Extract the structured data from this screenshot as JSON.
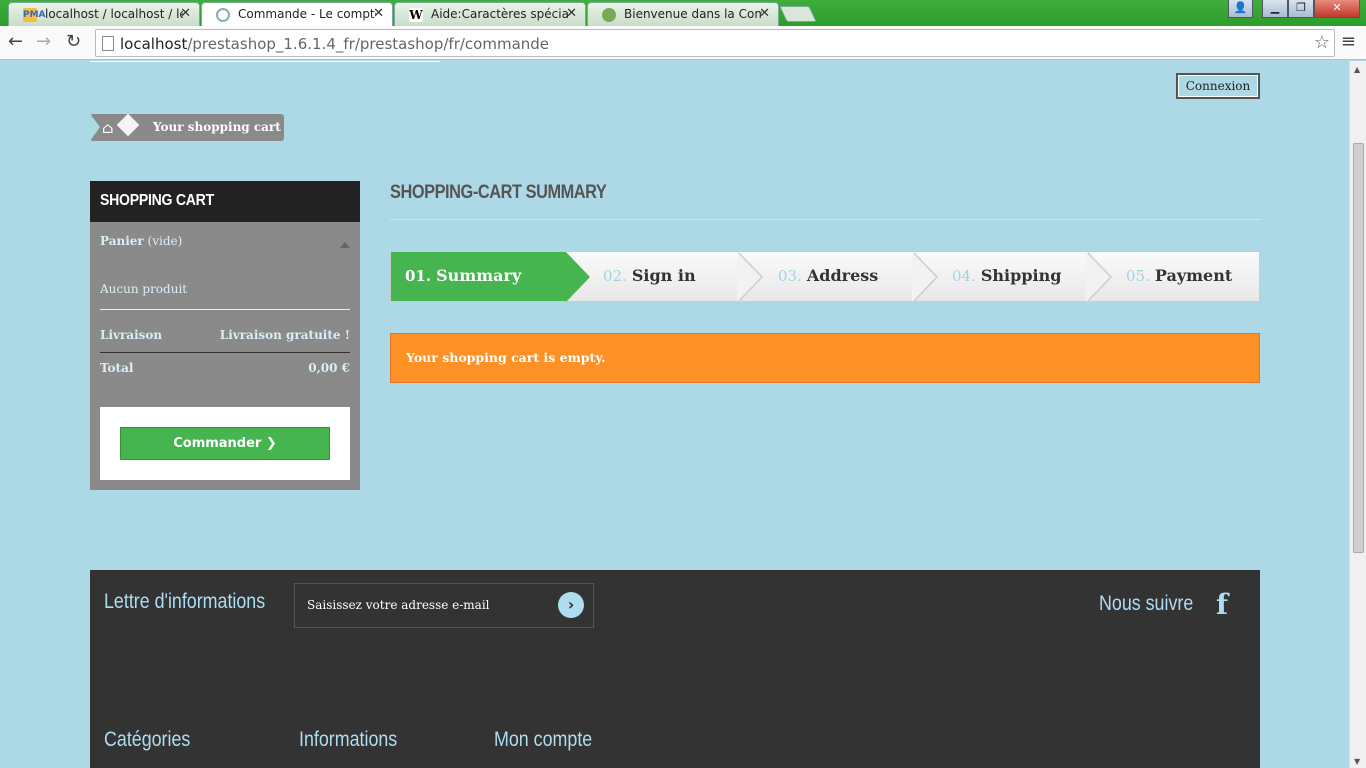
{
  "browser": {
    "tabs": [
      {
        "title": "localhost / localhost / leco",
        "icon": "phpmyadmin-icon"
      },
      {
        "title": "Commande - Le comptoir",
        "icon": "loading-icon",
        "active": true
      },
      {
        "title": "Aide:Caractères spéciaux p",
        "icon": "wikipedia-icon"
      },
      {
        "title": "Bienvenue dans la Commu",
        "icon": "prestashop-icon"
      }
    ],
    "url_host": "localhost",
    "url_path": "/prestashop_1.6.1.4_fr/prestashop/fr/commande"
  },
  "header": {
    "login_label": "Connexion",
    "breadcrumb": "Your shopping cart"
  },
  "cart": {
    "title": "SHOPPING CART",
    "panier_label": "Panier",
    "panier_status": "(vide)",
    "empty_text": "Aucun produit",
    "shipping_label": "Livraison",
    "shipping_value": "Livraison gratuite !",
    "total_label": "Total",
    "total_value": "0,00 €",
    "checkout_label": "Commander"
  },
  "main": {
    "title": "SHOPPING-CART SUMMARY",
    "steps": [
      {
        "num": "01.",
        "label": "Summary"
      },
      {
        "num": "02.",
        "label": "Sign in"
      },
      {
        "num": "03.",
        "label": "Address"
      },
      {
        "num": "04.",
        "label": "Shipping"
      },
      {
        "num": "05.",
        "label": "Payment"
      }
    ],
    "alert": "Your shopping cart is empty."
  },
  "footer": {
    "newsletter_title": "Lettre d'informations",
    "newsletter_placeholder": "Saisissez votre adresse e-mail",
    "follow_title": "Nous suivre",
    "col1": "Catégories",
    "col2": "Informations",
    "col3": "Mon compte"
  },
  "colors": {
    "background": "#add8e6",
    "accent_green": "#46b44f",
    "alert_orange": "#fe9126",
    "footer": "#333333"
  }
}
